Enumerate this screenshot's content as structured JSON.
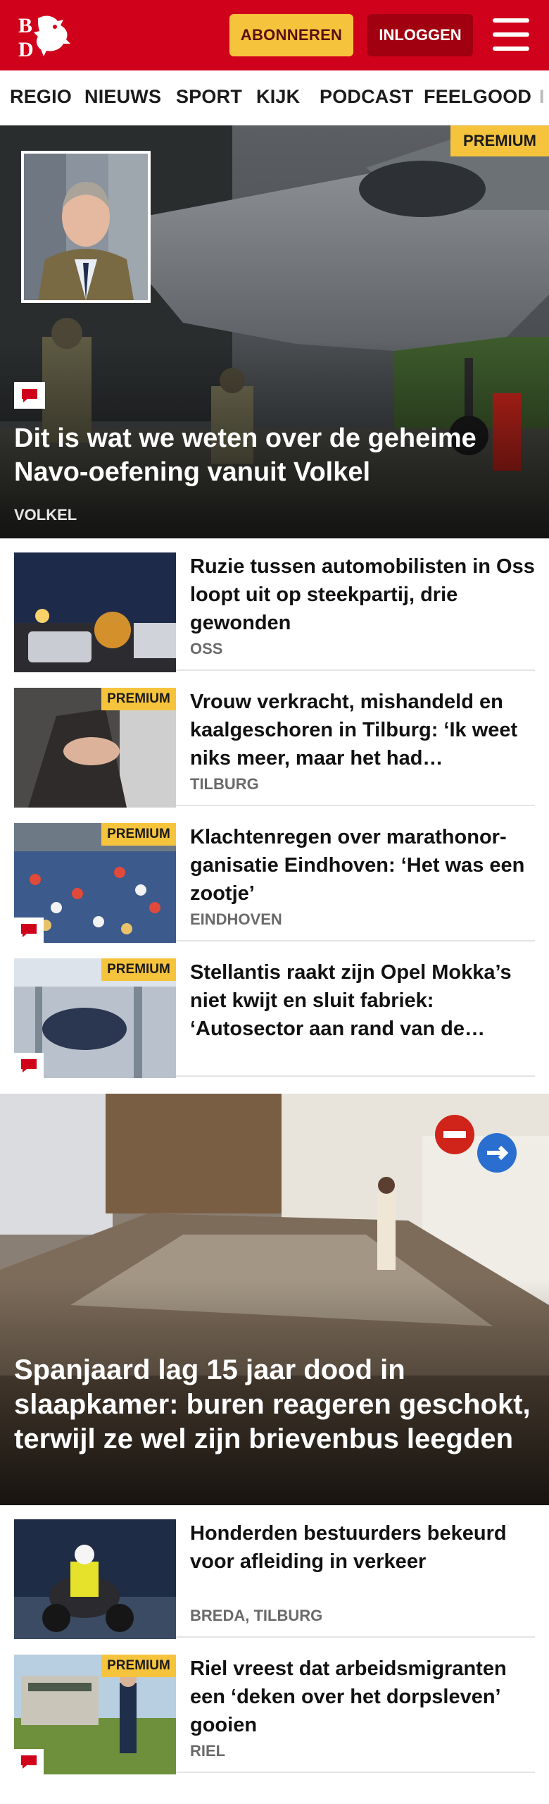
{
  "header": {
    "logo_text": "BD",
    "subscribe_label": "ABONNEREN",
    "login_label": "INLOGGEN",
    "colors": {
      "brand": "#d0021b",
      "accent": "#f6c43c",
      "login": "#a0000f"
    }
  },
  "nav": {
    "items": [
      {
        "label": "REGIO"
      },
      {
        "label": "NIEUWS"
      },
      {
        "label": "SPORT"
      },
      {
        "label": "KIJK"
      },
      {
        "label": "PODCAST"
      },
      {
        "label": "FEELGOOD"
      },
      {
        "label": "I"
      }
    ]
  },
  "hero": {
    "premium": "PREMIUM",
    "title": "Dit is wat we weten over de geheime Navo-oefening vanuit Volkel",
    "location": "VOLKEL",
    "icon": "comment-icon"
  },
  "articles": [
    {
      "title": "Ruzie tussen automobilisten in Oss loopt uit op steekpartij, drie gewonden",
      "location": "OSS",
      "premium": "",
      "comment": false
    },
    {
      "title": "Vrouw verkracht, mishandeld en kaalgeschoren in Tilburg: ‘Ik weet niks meer, maar het had…",
      "location": "TILBURG",
      "premium": "PREMIUM",
      "comment": false
    },
    {
      "title": "Klachtenregen over marathonor­ganisatie Eindhoven: ‘Het was een zootje’",
      "location": "EINDHOVEN",
      "premium": "PREMIUM",
      "comment": true
    },
    {
      "title": "Stellantis raakt zijn Opel Mokka’s niet kwijt en sluit fabriek: ‘Autosector aan rand van de…",
      "location": "",
      "premium": "PREMIUM",
      "comment": true
    }
  ],
  "hero2": {
    "title": "Spanjaard lag 15 jaar dood in slaapkamer: buren reageren geschokt, terwijl ze wel zijn brievenbus leegden"
  },
  "articles2": [
    {
      "title": "Honderden bestuurders bekeurd voor afleiding in verkeer",
      "location": "BREDA, TILBURG",
      "premium": "",
      "comment": false
    },
    {
      "title": "Riel vreest dat arbeidsmigranten een ‘deken over het dorpsleven’ gooien",
      "location": "RIEL",
      "premium": "PREMIUM",
      "comment": true
    }
  ]
}
